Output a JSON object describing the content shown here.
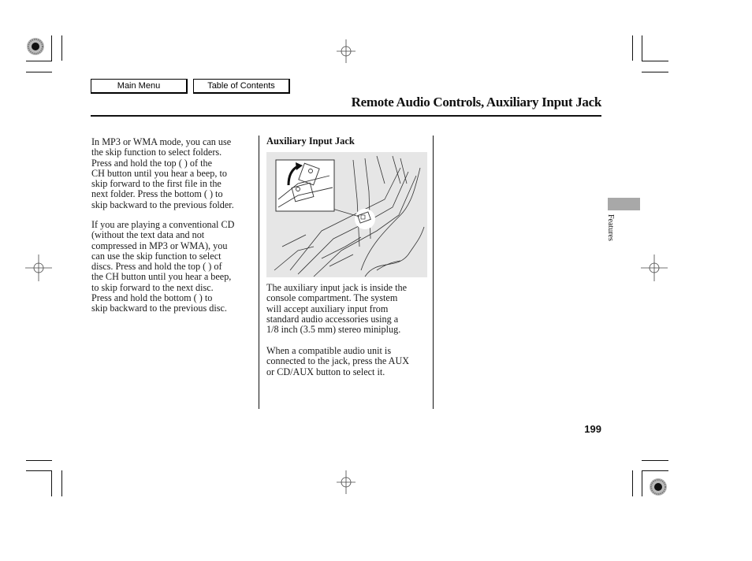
{
  "nav": {
    "main_menu": "Main Menu",
    "table_of_contents": "Table of Contents"
  },
  "header": {
    "title": "Remote Audio Controls, Auxiliary Input Jack"
  },
  "left_column": {
    "paragraphs": [
      "In MP3 or WMA mode, you can use\nthe skip function to select folders.\nPress and hold the top (    ) of the\nCH button until you hear a beep, to\nskip forward to the first file in the\nnext folder. Press the bottom (    ) to\nskip backward to the previous folder.",
      "If you are playing a conventional CD\n(without the text data and not\ncompressed in MP3 or WMA), you\ncan use the skip function to select\ndiscs. Press and hold the top (    ) of\nthe CH button until you hear a beep,\nto skip forward to the next disc.\nPress and hold the bottom (    ) to\nskip backward to the previous disc."
    ]
  },
  "middle_column": {
    "heading": "Auxiliary Input Jack",
    "figure": {
      "description": "Illustration of center console compartment with auxiliary input jack, inset showing jack cover flipping open"
    },
    "paragraphs": [
      "The auxiliary input jack is inside the\nconsole compartment. The system\nwill accept auxiliary input from\nstandard audio accessories using a\n1/8 inch (3.5 mm) stereo miniplug.",
      "When a compatible audio unit is\nconnected to the jack, press the AUX\nor CD/AUX button to select it."
    ]
  },
  "side_tab": {
    "label": "Features",
    "color": "#a8a8a8"
  },
  "footer": {
    "page_number": "199"
  }
}
